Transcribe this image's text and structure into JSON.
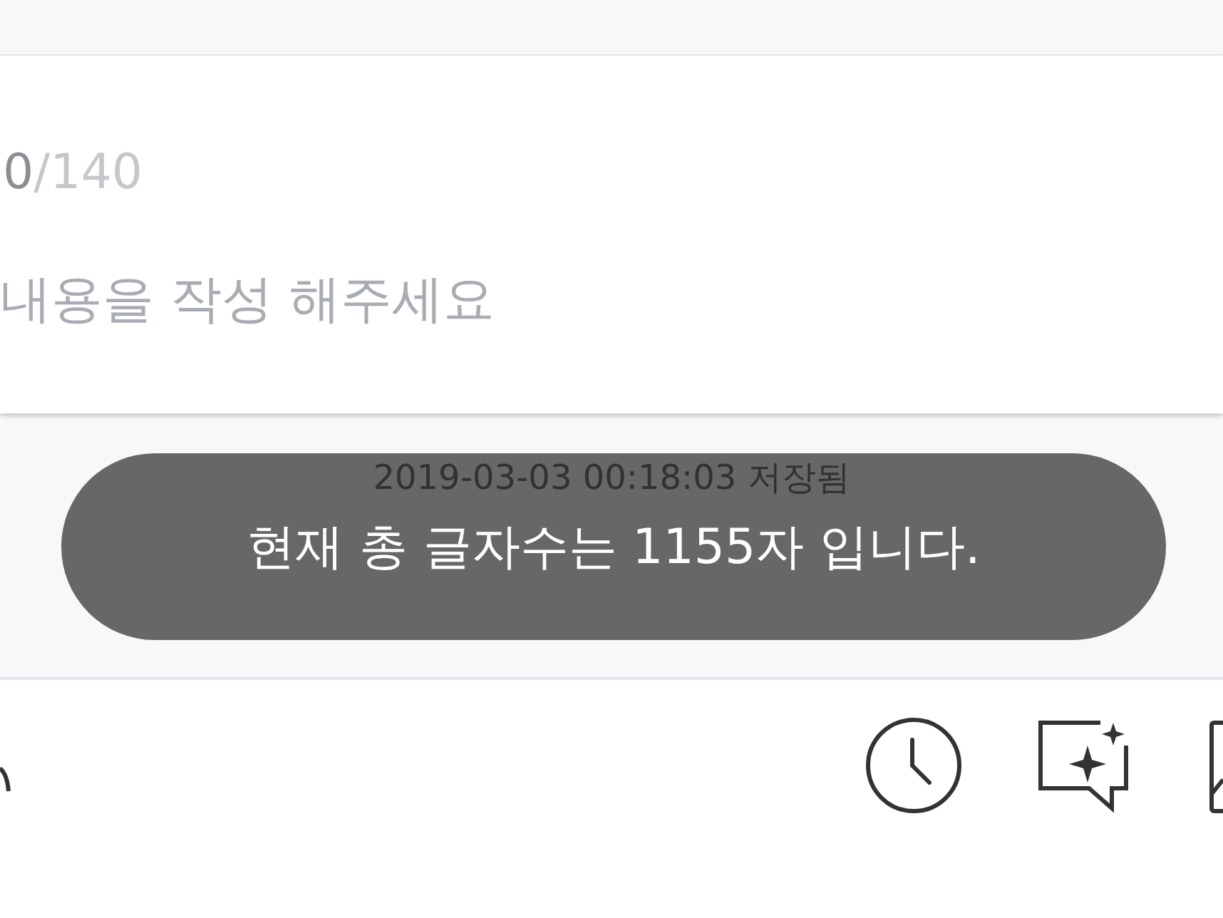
{
  "editor": {
    "count": "0",
    "limit": "/140",
    "placeholder": "내용을 작성 해주세요"
  },
  "saved_status": "2019-03-03 00:18:03 저장됨",
  "toast": "현재 총 글자수는 1155자 입니다.",
  "toolbar": {
    "icons": [
      {
        "kind": "partial"
      },
      {
        "kind": "clock"
      },
      {
        "kind": "sparkle-chat"
      },
      {
        "kind": "image"
      }
    ]
  }
}
